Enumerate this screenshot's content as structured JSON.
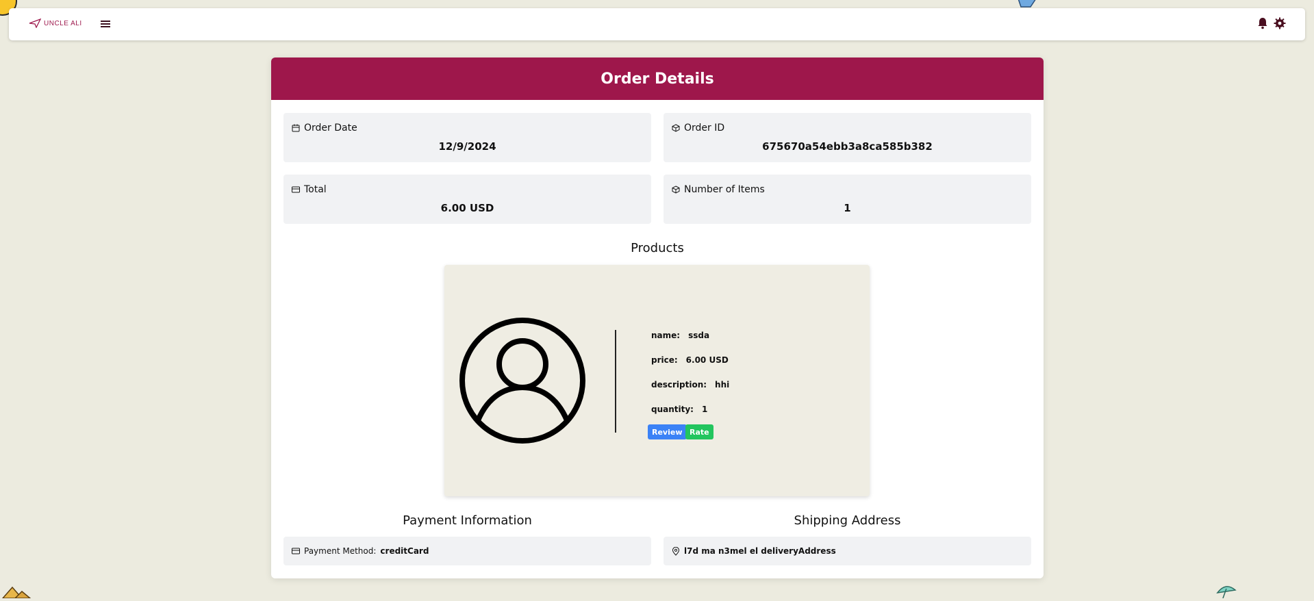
{
  "app": {
    "logo_text": "UNCLE ALI"
  },
  "colors": {
    "accent": "#9e174b",
    "review": "#3b82f6",
    "rate": "#22c55e",
    "background": "#ecebdf"
  },
  "page": {
    "title": "Order Details"
  },
  "order": {
    "date_label": "Order Date",
    "date_value": "12/9/2024",
    "id_label": "Order ID",
    "id_value": "675670a54ebb3a8ca585b382",
    "total_label": "Total",
    "total_value": "6.00 USD",
    "items_label": "Number of Items",
    "items_value": "1"
  },
  "products": {
    "title": "Products",
    "items": [
      {
        "name_label": "name:",
        "name": "ssda",
        "price_label": "price:",
        "price": "6.00 USD",
        "description_label": "description:",
        "description": "hhi",
        "quantity_label": "quantity:",
        "quantity": "1",
        "review_label": "Review",
        "rate_label": "Rate",
        "image_icon": "user-circle-icon"
      }
    ]
  },
  "payment": {
    "title": "Payment Information",
    "method_label": "Payment Method:",
    "method_value": "creditCard"
  },
  "shipping": {
    "title": "Shipping Address",
    "address": "l7d ma n3mel el deliveryAddress"
  }
}
